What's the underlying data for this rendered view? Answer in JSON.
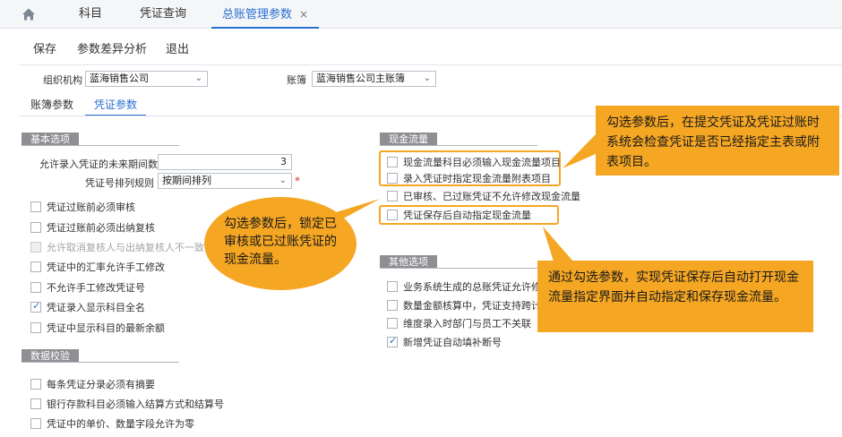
{
  "tabs": [
    {
      "label": "科目"
    },
    {
      "label": "凭证查询"
    },
    {
      "label": "总账管理参数",
      "close": "×"
    }
  ],
  "toolbar": {
    "save": "保存",
    "compare": "参数差异分析",
    "exit": "退出"
  },
  "filters": {
    "org_label": "组织机构",
    "org_value": "蓝海销售公司",
    "book_label": "账簿",
    "book_value": "蓝海销售公司主账簿"
  },
  "subtabs": {
    "book_params": "账簿参数",
    "voucher_params": "凭证参数"
  },
  "basic": {
    "title": "基本选项",
    "future_periods_label": "允许录入凭证的未来期间数",
    "future_periods_value": "3",
    "sort_label": "凭证号排列规则",
    "sort_value": "按期间排列",
    "required_mark": "*",
    "options": [
      {
        "label": "凭证过账前必须审核",
        "checked": false,
        "disabled": false
      },
      {
        "label": "凭证过账前必须出纳复核",
        "checked": false,
        "disabled": false
      },
      {
        "label": "允许取消复核人与出纳复核人不一致",
        "checked": false,
        "disabled": true
      },
      {
        "label": "凭证中的汇率允许手工修改",
        "checked": false,
        "disabled": false
      },
      {
        "label": "不允许手工修改凭证号",
        "checked": false,
        "disabled": false
      },
      {
        "label": "凭证录入显示科目全名",
        "checked": true,
        "disabled": false
      },
      {
        "label": "凭证中显示科目的最新余额",
        "checked": false,
        "disabled": false
      }
    ]
  },
  "data_check": {
    "title": "数据校验",
    "options": [
      {
        "label": "每条凭证分录必须有摘要",
        "checked": false
      },
      {
        "label": "银行存款科目必须输入结算方式和结算号",
        "checked": false
      },
      {
        "label": "凭证中的单价、数量字段允许为零",
        "checked": false
      }
    ]
  },
  "cashflow": {
    "title": "现金流量",
    "options": [
      {
        "label": "现金流量科目必须输入现金流量项目",
        "checked": false
      },
      {
        "label": "录入凭证时指定现金流量附表项目",
        "checked": false
      },
      {
        "label": "已审核、已过账凭证不允许修改现金流量",
        "checked": false
      },
      {
        "label": "凭证保存后自动指定现金流量",
        "checked": false
      }
    ]
  },
  "other": {
    "title": "其他选项",
    "options": [
      {
        "label": "业务系统生成的总账凭证允许修改",
        "checked": false
      },
      {
        "label": "数量金额核算中，凭证支持跨计量单位",
        "checked": false
      },
      {
        "label": "维度录入时部门与员工不关联",
        "checked": false
      },
      {
        "label": "新增凭证自动填补断号",
        "checked": true
      }
    ]
  },
  "callouts": {
    "top_right": "勾选参数后，在提交凭证及凭证过账时系统会检查凭证是否已经指定主表或附表项目。",
    "middle": "勾选参数后，锁定已审核或已过账凭证的现金流量。",
    "bottom_right": "通过勾选参数，实现凭证保存后自动打开现金流量指定界面并自动指定和保存现金流量。"
  },
  "colors": {
    "accent": "#2b6fd1",
    "callout": "#f5a623",
    "section_tag": "#8e8e93"
  },
  "icons": {
    "home": "home-icon",
    "close": "close-icon",
    "chevron": "chevron-down-icon",
    "check": "check-icon"
  }
}
